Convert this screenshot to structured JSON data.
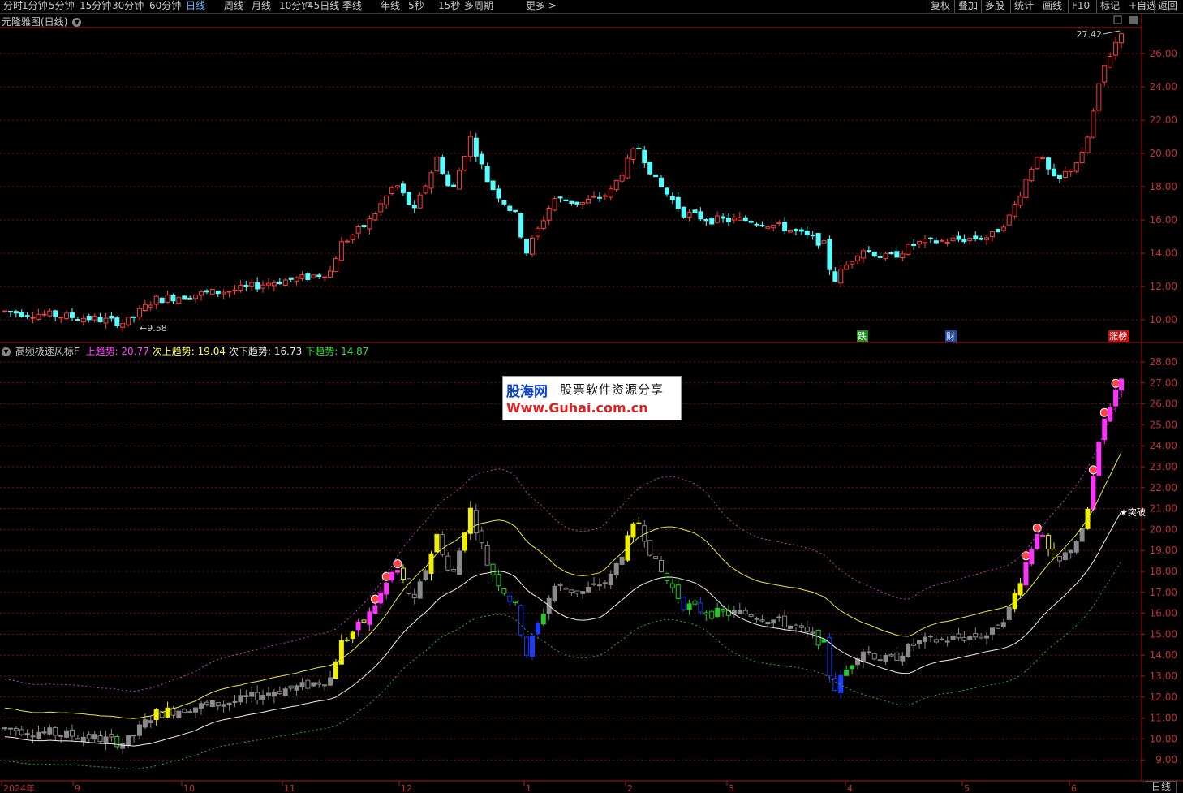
{
  "toolbar": {
    "periods": [
      "分时",
      "1分钟",
      "5分钟",
      "15分钟",
      "30分钟",
      "60分钟",
      "日线",
      "周线",
      "月线",
      "10分钟",
      "45日线",
      "季线",
      "年线",
      "5秒",
      "15秒",
      "多周期",
      "更多 >"
    ],
    "active_period": "日线",
    "right_buttons": [
      "复权",
      "叠加",
      "多股",
      "统计",
      "画线",
      "F10",
      "标记",
      "+自选",
      "返回"
    ]
  },
  "main_panel": {
    "title": "元隆雅图(日线)",
    "high_label": "27.42",
    "low_label": "9.58",
    "y_ticks": [
      "26.00",
      "24.00",
      "22.00",
      "20.00",
      "18.00",
      "16.00",
      "14.00",
      "12.00",
      "10.00"
    ],
    "markers": [
      "跌",
      "财",
      "涨榜"
    ]
  },
  "indicator_panel": {
    "name": "高频极速风标F",
    "series": [
      {
        "label": "上趋势:",
        "value": "20.77",
        "color": "#ff44ff"
      },
      {
        "label": "次上趋势:",
        "value": "19.04",
        "color": "#ffff55"
      },
      {
        "label": "次下趋势:",
        "value": "16.73",
        "color": "#e6e6e6"
      },
      {
        "label": "下趋势:",
        "value": "14.87",
        "color": "#33dd33"
      }
    ],
    "y_ticks": [
      "28.00",
      "27.00",
      "26.00",
      "25.00",
      "24.00",
      "23.00",
      "22.00",
      "21.00",
      "20.00",
      "19.00",
      "18.00",
      "17.00",
      "16.00",
      "15.00",
      "14.00",
      "13.00",
      "12.00",
      "11.00",
      "10.00",
      "9.00"
    ],
    "breakout_label": "★突破"
  },
  "x_axis": {
    "labels": [
      "2024年",
      "9",
      "10",
      "11",
      "12",
      "1",
      "2",
      "3",
      "4",
      "5",
      "6"
    ]
  },
  "watermark": {
    "logo": "股海网",
    "slogan": "股票软件资源分享",
    "url": "Www.Guhai.com.cn"
  },
  "bottom_tab": "日线",
  "colors": {
    "up": "#ff3b3b",
    "down": "#55ffff",
    "grid": "#7a1010",
    "axis": "#b01818"
  }
}
